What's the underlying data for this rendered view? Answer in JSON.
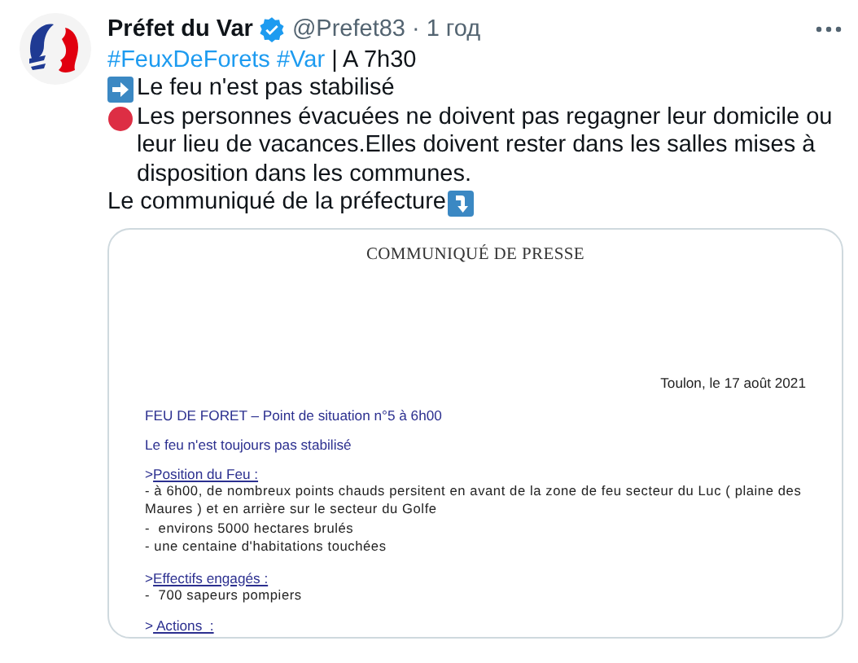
{
  "tweet": {
    "name": "Préfet du Var",
    "verified": true,
    "handle": "@Prefet83",
    "separator": "·",
    "time": "1 год",
    "tags": [
      {
        "kind": "hashtag",
        "text": "#FeuxDeForets"
      },
      {
        "kind": "hashtag",
        "text": "#Var"
      },
      {
        "kind": "plain",
        "text": "| A 7h30"
      }
    ],
    "lines": [
      {
        "kind": "arrow-lead",
        "text": "Le feu n'est pas stabilisé"
      },
      {
        "kind": "dot-lead",
        "text": "Les personnes évacuées ne doivent pas regagner leur domicile ou leur lieu de vacances.Elles doivent rester dans les salles mises à disposition dans les communes."
      },
      {
        "kind": "arrow-trail",
        "text": "Le communiqué de la préfecture"
      }
    ]
  },
  "document": {
    "title": "COMMUNIQUÉ DE PRESSE",
    "date": "Toulon, le 17 août 2021",
    "heading": "FEU DE FORET – Point de situation n°5 à 6h00",
    "subheading": "Le feu n'est toujours pas stabilisé",
    "sections": [
      {
        "marker": ">",
        "title": "Position du Feu :",
        "lines": [
          "- à 6h00, de nombreux points chauds persitent en avant de la zone de feu secteur du Luc ( plaine des Maures ) et en arrière sur le secteur du Golfe",
          "-  environs 5000 hectares brulés",
          "- une centaine d'habitations touchées"
        ]
      },
      {
        "marker": ">",
        "title": "Effectifs engagés :",
        "lines": [
          "-  700 sapeurs pompiers"
        ]
      },
      {
        "marker": ">",
        "title": " Actions  :"
      }
    ]
  }
}
